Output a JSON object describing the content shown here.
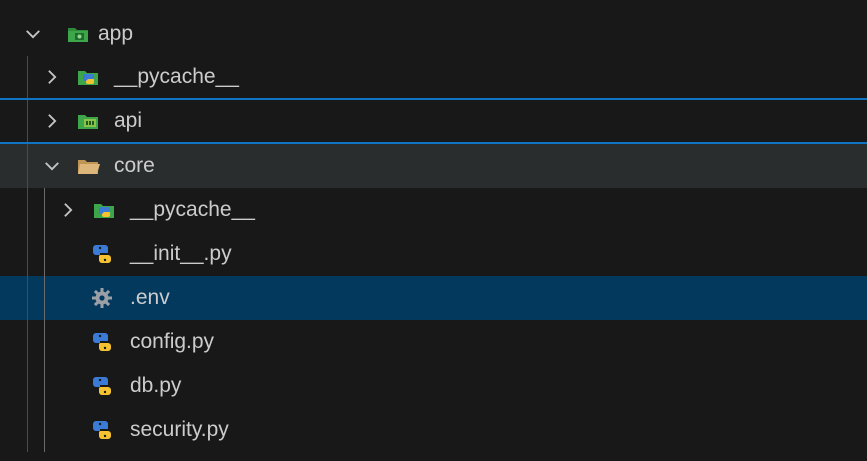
{
  "explorer": {
    "items": [
      {
        "label": "app",
        "kind": "folder-open",
        "icon": "app-folder-icon",
        "expanded": true
      },
      {
        "label": "__pycache__",
        "kind": "folder-closed",
        "icon": "python-folder-icon",
        "expanded": false
      },
      {
        "label": "api",
        "kind": "folder-closed",
        "icon": "api-folder-icon",
        "expanded": false
      },
      {
        "label": "core",
        "kind": "folder-open",
        "icon": "folder-open-icon",
        "expanded": true
      },
      {
        "label": "__pycache__",
        "kind": "folder-closed",
        "icon": "python-folder-icon",
        "expanded": false
      },
      {
        "label": "__init__.py",
        "kind": "file",
        "icon": "python-file-icon"
      },
      {
        "label": ".env",
        "kind": "file",
        "icon": "gear-icon",
        "selected": true
      },
      {
        "label": "config.py",
        "kind": "file",
        "icon": "python-file-icon"
      },
      {
        "label": "db.py",
        "kind": "file",
        "icon": "python-file-icon"
      },
      {
        "label": "security.py",
        "kind": "file",
        "icon": "python-file-icon"
      }
    ]
  },
  "colors": {
    "background": "#181818",
    "selected_row": "#04395e",
    "hover_row": "#2a2d2e",
    "focus_border": "#0f74c4",
    "python_blue": "#3a7bd5",
    "python_yellow": "#f5c332",
    "folder_green": "#3ea64a"
  }
}
